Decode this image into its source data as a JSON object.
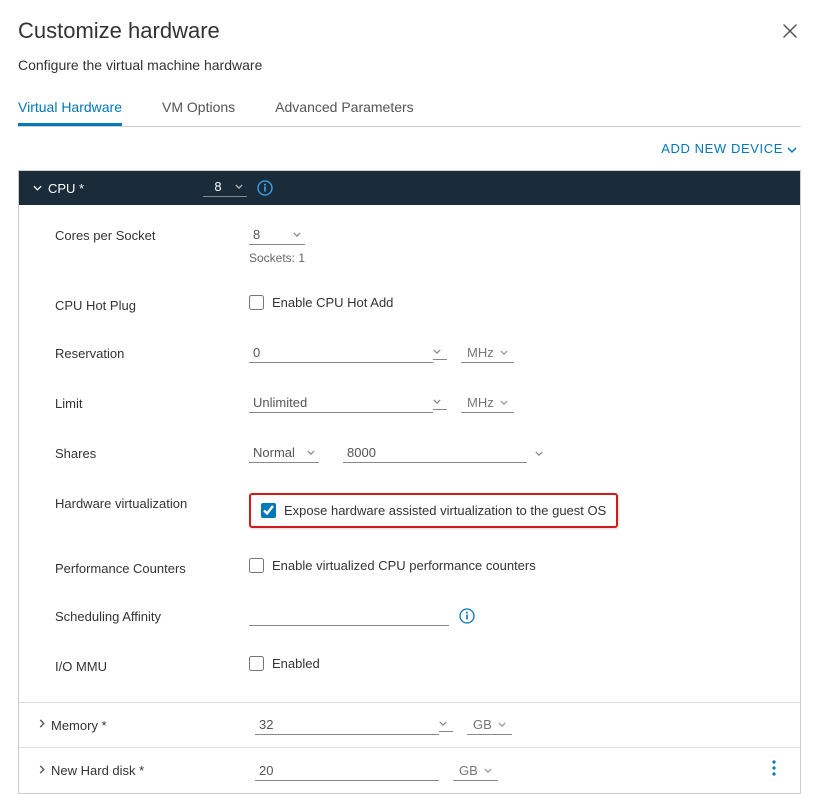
{
  "dialog": {
    "title": "Customize hardware",
    "subtitle": "Configure the virtual machine hardware"
  },
  "tabs": [
    {
      "label": "Virtual Hardware",
      "active": true
    },
    {
      "label": "VM Options",
      "active": false
    },
    {
      "label": "Advanced Parameters",
      "active": false
    }
  ],
  "add_device_label": "ADD NEW DEVICE",
  "cpu_section": {
    "header_label": "CPU *",
    "header_value": "8",
    "cores_label": "Cores per Socket",
    "cores_value": "8",
    "sockets_hint": "Sockets: 1",
    "hotplug_label": "CPU Hot Plug",
    "hotplug_chk": "Enable CPU Hot Add",
    "reservation_label": "Reservation",
    "reservation_value": "0",
    "reservation_unit": "MHz",
    "limit_label": "Limit",
    "limit_value": "Unlimited",
    "limit_unit": "MHz",
    "shares_label": "Shares",
    "shares_mode": "Normal",
    "shares_value": "8000",
    "hwv_label": "Hardware virtualization",
    "hwv_chk": "Expose hardware assisted virtualization to the guest OS",
    "perf_label": "Performance Counters",
    "perf_chk": "Enable virtualized CPU performance counters",
    "affinity_label": "Scheduling Affinity",
    "iommu_label": "I/O MMU",
    "iommu_chk": "Enabled"
  },
  "memory_row": {
    "label": "Memory *",
    "value": "32",
    "unit": "GB"
  },
  "disk_row": {
    "label": "New Hard disk *",
    "value": "20",
    "unit": "GB"
  }
}
